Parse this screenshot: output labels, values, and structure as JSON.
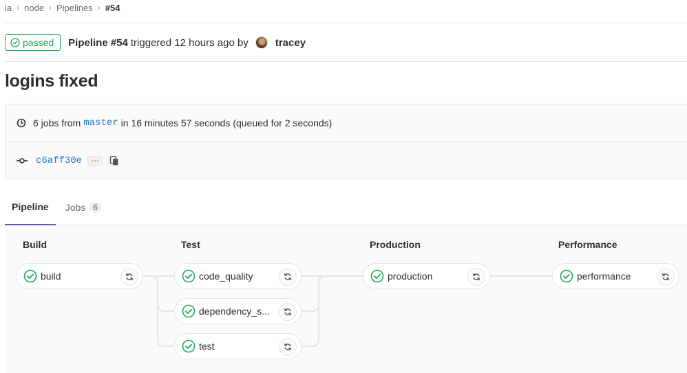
{
  "breadcrumb": {
    "items": [
      "ia",
      "node",
      "Pipelines"
    ],
    "current": "#54"
  },
  "header": {
    "status": "passed",
    "pipeline_label": "Pipeline #54",
    "triggered_text": "triggered 12 hours ago by",
    "author": "tracey"
  },
  "title": "logins fixed",
  "info": {
    "jobs_text": "6 jobs from",
    "ref": "master",
    "duration_text": "in 16 minutes 57 seconds (queued for 2 seconds)",
    "sha": "c6aff30e",
    "ellipsis": "···"
  },
  "tabs": [
    {
      "label": "Pipeline",
      "active": true
    },
    {
      "label": "Jobs",
      "count": "6",
      "active": false
    }
  ],
  "stages": [
    {
      "name": "Build",
      "jobs": [
        "build"
      ]
    },
    {
      "name": "Test",
      "jobs": [
        "code_quality",
        "dependency_s...",
        "test"
      ]
    },
    {
      "name": "Production",
      "jobs": [
        "production"
      ]
    },
    {
      "name": "Performance",
      "jobs": [
        "performance"
      ]
    }
  ],
  "colors": {
    "success": "#1aaa55",
    "link": "#1f78d1",
    "active_tab": "#6b4fbb"
  }
}
